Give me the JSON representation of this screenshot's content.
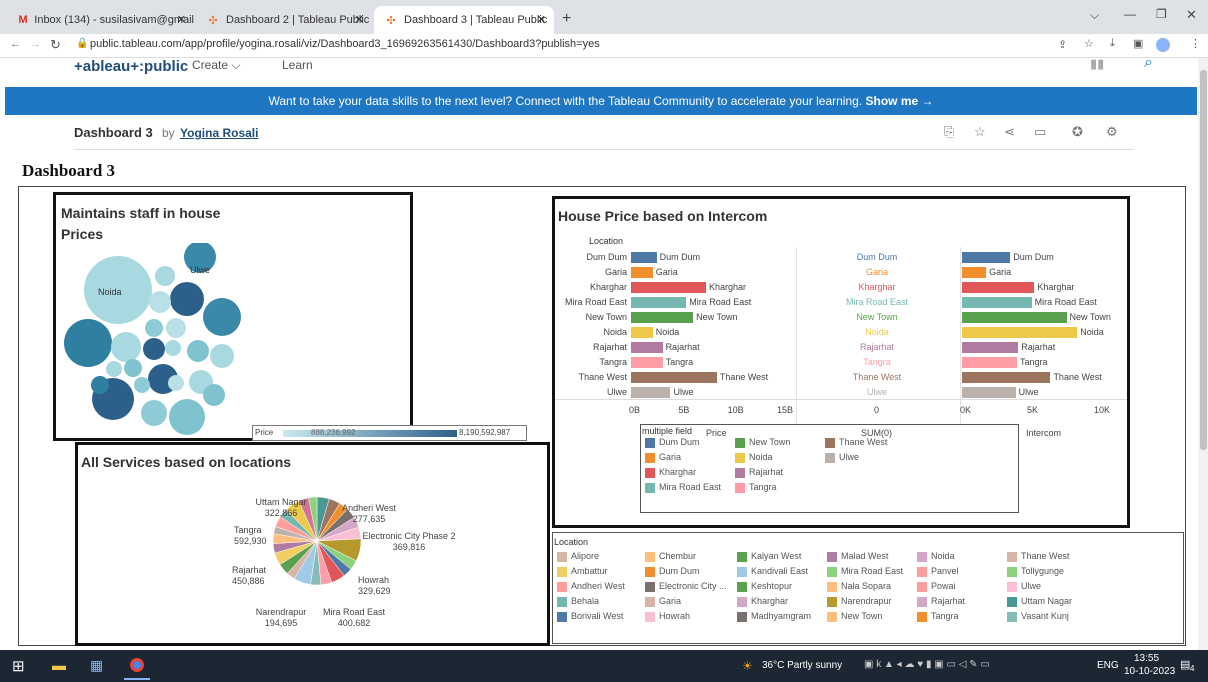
{
  "browser": {
    "tabs": [
      {
        "title": "Inbox (134) - susilasivam@gmail",
        "icon": "M"
      },
      {
        "title": "Dashboard 2 | Tableau Public",
        "icon": "✣"
      },
      {
        "title": "Dashboard 3 | Tableau Public",
        "icon": "✣"
      }
    ],
    "new_tab": "+",
    "url": "public.tableau.com/app/profile/yogina.rosali/viz/Dashboard3_16969263561430/Dashboard3?publish=yes"
  },
  "tableau_header": {
    "logo": "+ableau+:public",
    "nav": [
      "Create ⌵",
      "Learn"
    ]
  },
  "banner": {
    "text": "Want to take your data skills to the next level? Connect with the Tableau Community to accelerate your learning.",
    "link": "Show me →"
  },
  "viz": {
    "title": "Dashboard 3",
    "by": "by",
    "author": "Yogina Rosali"
  },
  "dashboard": {
    "title": "Dashboard 3",
    "bubble_panel": {
      "title_line1": "Maintains staff in house",
      "title_line2": "Prices",
      "labels": [
        "Noida",
        "Ulwe"
      ],
      "legend_title": "Price",
      "legend_min": "888,236,992",
      "legend_max": "8,190,592,987"
    },
    "pie_panel": {
      "title": "All Services based on locations",
      "labels": [
        {
          "name": "Uttam Nagar",
          "value": "322,866"
        },
        {
          "name": "Andheri West",
          "value": "277,635"
        },
        {
          "name": "Tangra",
          "value": "592,930"
        },
        {
          "name": "Electronic City Phase 2",
          "value": "369,816"
        },
        {
          "name": "Rajarhat",
          "value": "450,886"
        },
        {
          "name": "Howrah",
          "value": "329,629"
        },
        {
          "name": "Narendrapur",
          "value": "194,695"
        },
        {
          "name": "Mira Road East",
          "value": "400,682"
        }
      ]
    },
    "bar_panel": {
      "title": "House Price based on Intercom",
      "row_header": "Location",
      "axis1": {
        "ticks": [
          "0B",
          "5B",
          "10B",
          "15B"
        ],
        "title": "Price"
      },
      "axis2": {
        "ticks": [
          "0"
        ],
        "title": "SUM(0)"
      },
      "axis3": {
        "ticks": [
          "0K",
          "5K",
          "10K"
        ],
        "title": "Intercom"
      },
      "legend_title": "multiple field",
      "legend": [
        {
          "name": "Dum Dum",
          "color": "#4e79a7"
        },
        {
          "name": "New Town",
          "color": "#59a14f"
        },
        {
          "name": "Thane West",
          "color": "#9c755f"
        },
        {
          "name": "Garia",
          "color": "#f28e2b"
        },
        {
          "name": "Noida",
          "color": "#edc948"
        },
        {
          "name": "Ulwe",
          "color": "#bab0ac"
        },
        {
          "name": "Kharghar",
          "color": "#e15759"
        },
        {
          "name": "Rajarhat",
          "color": "#b07aa1"
        },
        {
          "name": "Mira Road East",
          "color": "#76b7b2"
        },
        {
          "name": "Tangra",
          "color": "#ff9da7"
        }
      ]
    },
    "location_legend": {
      "title": "Location",
      "items": [
        {
          "name": "Alipore",
          "color": "#d7b5a6"
        },
        {
          "name": "Chembur",
          "color": "#ffbe7d"
        },
        {
          "name": "Kalyan West",
          "color": "#59a14f"
        },
        {
          "name": "Malad West",
          "color": "#b07aa1"
        },
        {
          "name": "Noida",
          "color": "#d4a6c8"
        },
        {
          "name": "Thane West",
          "color": "#d7b5a6"
        },
        {
          "name": "Ambattur",
          "color": "#f1ce63"
        },
        {
          "name": "Dum Dum",
          "color": "#f28e2b"
        },
        {
          "name": "Kandivali East",
          "color": "#a0cbe8"
        },
        {
          "name": "Mira Road East",
          "color": "#8cd17d"
        },
        {
          "name": "Panvel",
          "color": "#ff9d9a"
        },
        {
          "name": "Tollygunge",
          "color": "#8cd17d"
        },
        {
          "name": "Andheri West",
          "color": "#ff9d9a"
        },
        {
          "name": "Electronic City ...",
          "color": "#79706e"
        },
        {
          "name": "Keshtopur",
          "color": "#59a14f"
        },
        {
          "name": "Nala Sopara",
          "color": "#ffbe7d"
        },
        {
          "name": "Powai",
          "color": "#ff9d9a"
        },
        {
          "name": "Ulwe",
          "color": "#fabfd2"
        },
        {
          "name": "Behala",
          "color": "#76b7b2"
        },
        {
          "name": "Garia",
          "color": "#d7b5a6"
        },
        {
          "name": "Kharghar",
          "color": "#d4a6c8"
        },
        {
          "name": "Narendrapur",
          "color": "#b6992d"
        },
        {
          "name": "Rajarhat",
          "color": "#d4a6c8"
        },
        {
          "name": "Uttam Nagar",
          "color": "#499894"
        },
        {
          "name": "Borivali West",
          "color": "#4e79a7"
        },
        {
          "name": "Howrah",
          "color": "#fabfd2"
        },
        {
          "name": "Madhyamgram",
          "color": "#79706e"
        },
        {
          "name": "New Town",
          "color": "#ffbe7d"
        },
        {
          "name": "Tangra",
          "color": "#f28e2b"
        },
        {
          "name": "Vasant Kunj",
          "color": "#86bcb6"
        }
      ]
    }
  },
  "chart_data": [
    {
      "type": "bar",
      "title": "House Price based on Intercom",
      "categories": [
        "Dum Dum",
        "Garia",
        "Kharghar",
        "Mira Road East",
        "New Town",
        "Noida",
        "Rajarhat",
        "Tangra",
        "Thane West",
        "Ulwe"
      ],
      "colors": [
        "#4e79a7",
        "#f28e2b",
        "#e15759",
        "#76b7b2",
        "#59a14f",
        "#edc948",
        "#b07aa1",
        "#ff9da7",
        "#9c755f",
        "#bab0ac"
      ],
      "series": [
        {
          "name": "Price",
          "values": [
            2.6,
            2.2,
            7.6,
            5.6,
            6.3,
            2.2,
            3.2,
            3.2,
            8.7,
            4.0
          ]
        },
        {
          "name": "SUM(0)",
          "values": [
            0,
            0,
            0,
            0,
            0,
            0,
            0,
            0,
            0,
            0
          ]
        },
        {
          "name": "Intercom",
          "values": [
            3600,
            1800,
            5400,
            5200,
            7800,
            8600,
            4200,
            4100,
            6600,
            4000
          ]
        }
      ],
      "xlim_price": [
        0,
        15
      ],
      "xlim_intercom": [
        0,
        10000
      ]
    },
    {
      "type": "pie",
      "title": "All Services based on locations",
      "labels": [
        "Uttam Nagar",
        "Andheri West",
        "Tangra",
        "Electronic City Phase 2",
        "Rajarhat",
        "Howrah",
        "Narendrapur",
        "Mira Road East"
      ],
      "values": [
        322866,
        277635,
        592930,
        369816,
        450886,
        329629,
        194695,
        400682
      ]
    }
  ],
  "taskbar": {
    "weather": "36°C  Partly sunny",
    "lang": "ENG",
    "time": "13:55",
    "date": "10-10-2023",
    "notif": "4"
  }
}
